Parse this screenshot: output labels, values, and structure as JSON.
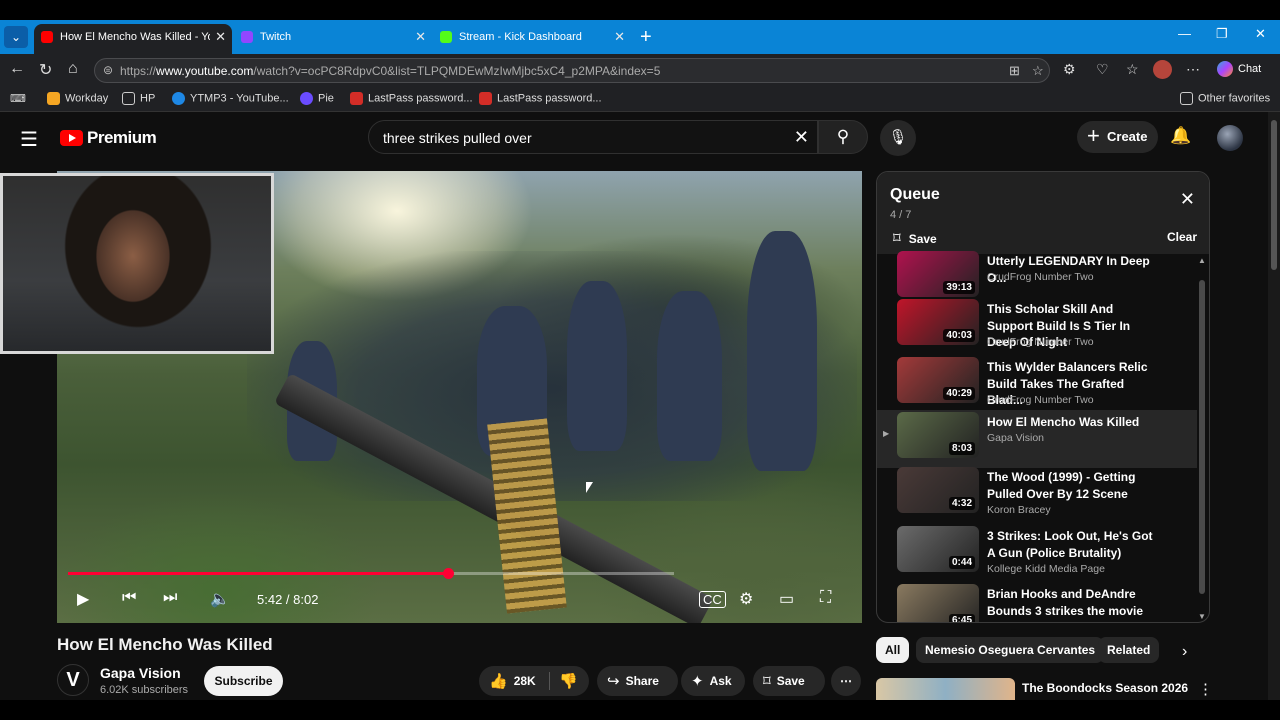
{
  "browser": {
    "tabs": [
      {
        "title": "How El Mencho Was Killed - YouTube",
        "fav_color": "#ff0000",
        "active": true
      },
      {
        "title": "Twitch",
        "fav_color": "#9146ff",
        "active": false
      },
      {
        "title": "Stream - Kick Dashboard",
        "fav_color": "#53fc18",
        "active": false
      }
    ],
    "url_prefix": "https://",
    "url_host": "www.youtube.com",
    "url_path": "/watch?v=ocPC8RdpvC0&list=TLPQMDEwMzIwMjbc5xC4_p2MPA&index=5",
    "chat_label": "Chat",
    "bookmarks": [
      {
        "label": "Workday",
        "color": "#f5a623"
      },
      {
        "label": "HP",
        "color": "#555"
      },
      {
        "label": "YTMP3 - YouTube...",
        "color": "#1e88e5"
      },
      {
        "label": "Pie",
        "color": "#6a4cff"
      },
      {
        "label": "LastPass password...",
        "color": "#d32d27"
      },
      {
        "label": "LastPass password...",
        "color": "#d32d27"
      }
    ],
    "other_favorites": "Other favorites"
  },
  "youtube": {
    "logo_text": "Premium",
    "search_query": "three strikes pulled over",
    "create_label": "Create"
  },
  "player": {
    "time": "5:42 / 8:02",
    "progress": 0.71,
    "title": "How El Mencho Was Killed"
  },
  "channel": {
    "name": "Gapa Vision",
    "subscribers": "6.02K subscribers",
    "avatar_letter": "V",
    "subscribe_label": "Subscribe"
  },
  "actions": {
    "likes": "28K",
    "share": "Share",
    "ask": "Ask",
    "save": "Save"
  },
  "queue": {
    "title": "Queue",
    "count": "4 / 7",
    "save_label": "Save",
    "clear_label": "Clear",
    "items": [
      {
        "title": "Utterly LEGENDARY In Deep O...",
        "channel": "CrudFrog Number Two",
        "duration": "39:13",
        "thumb": "#b0124e"
      },
      {
        "title": "This Scholar Skill And Support Build Is S Tier In Deep Of Night",
        "channel": "CrudFrog Number Two",
        "duration": "40:03",
        "thumb": "#c0152a"
      },
      {
        "title": "This Wylder Balancers Relic Build Takes The Grafted Blad...",
        "channel": "CrudFrog Number Two",
        "duration": "40:29",
        "thumb": "#a33a3a"
      },
      {
        "title": "How El Mencho Was Killed",
        "channel": "Gapa Vision",
        "duration": "8:03",
        "thumb": "#5b6a48"
      },
      {
        "title": "The Wood (1999) - Getting Pulled Over By 12 Scene",
        "channel": "Koron Bracey",
        "duration": "4:32",
        "thumb": "#4a3a38"
      },
      {
        "title": "3 Strikes: Look Out, He's Got A Gun (Police Brutality)",
        "channel": "Kollege Kidd Media Page",
        "duration": "0:44",
        "thumb": "#6b6b6b"
      },
      {
        "title": "Brian Hooks and DeAndre Bounds 3 strikes the movie",
        "channel": "",
        "duration": "6:45",
        "thumb": "#8a7a60"
      }
    ]
  },
  "chips": [
    "All",
    "Nemesio Oseguera Cervantes",
    "Related"
  ],
  "recommended": {
    "title": "The Boondocks Season 2026"
  }
}
